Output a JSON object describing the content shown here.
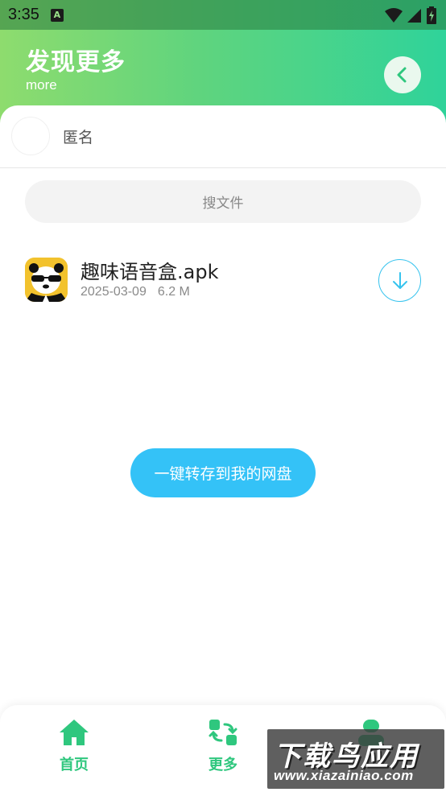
{
  "status_bar": {
    "time": "3:35",
    "notification_badge": "A"
  },
  "header": {
    "title": "发现更多",
    "subtitle": "more"
  },
  "user": {
    "name": "匿名"
  },
  "search": {
    "placeholder": "搜文件"
  },
  "files": [
    {
      "name": "趣味语音盒.apk",
      "date": "2025-03-09",
      "size": "6.2 M",
      "icon": "panda-app-icon"
    }
  ],
  "actions": {
    "save_all_label": "一键转存到我的网盘"
  },
  "tabbar": {
    "items": [
      {
        "label": "首页",
        "icon": "home-icon"
      },
      {
        "label": "更多",
        "icon": "refresh-grid-icon"
      },
      {
        "label": "",
        "icon": "person-icon"
      }
    ]
  },
  "watermark": {
    "title": "下载鸟应用",
    "url": "www.xiazainiao.com"
  },
  "colors": {
    "accent_green": "#2fc77e",
    "accent_blue": "#34c2f7",
    "gradient_start": "#8edc6e",
    "gradient_end": "#2fd39a"
  }
}
